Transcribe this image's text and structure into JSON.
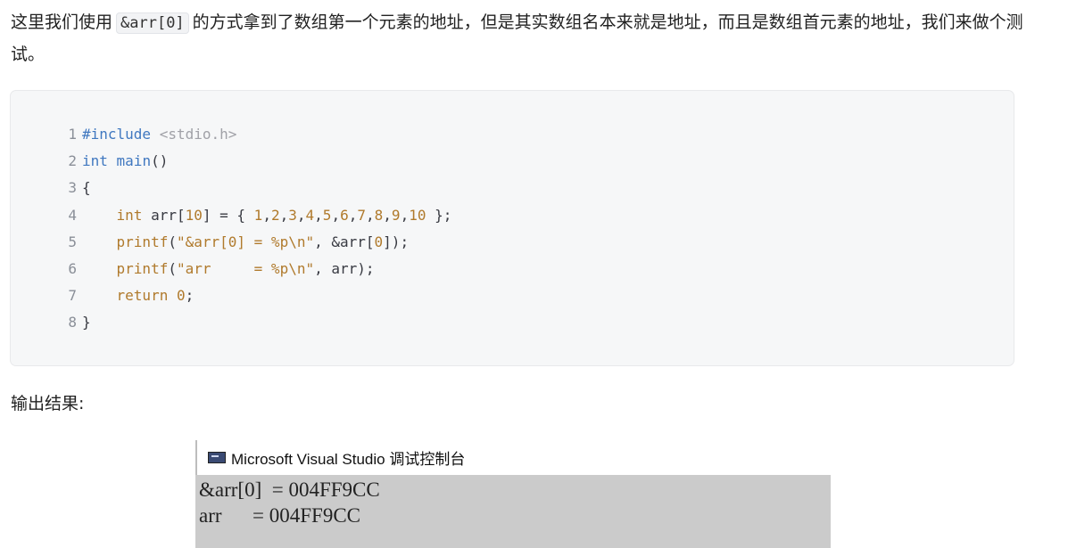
{
  "paragraph": {
    "before_code": "这里我们使用",
    "inline_code": "&arr[0]",
    "after_code": "的方式拿到了数组第一个元素的地址，但是其实数组名本来就是地址，而且是数组首元素的地址，我们来做个测试。"
  },
  "code_block": {
    "lines": [
      {
        "num": "1"
      },
      {
        "num": "2"
      },
      {
        "num": "3"
      },
      {
        "num": "4"
      },
      {
        "num": "5"
      },
      {
        "num": "6"
      },
      {
        "num": "7"
      },
      {
        "num": "8"
      }
    ],
    "tokens": {
      "l1_directive": "#include",
      "l1_header": " <stdio.h>",
      "l2_type": "int",
      "l2_fn": " main",
      "l2_rest": "()",
      "l3": "{",
      "l4_indent": "    ",
      "l4_type": "int",
      "l4_a": " arr[",
      "l4_size": "10",
      "l4_b": "] = { ",
      "l4_n1": "1",
      "l4_n2": "2",
      "l4_n3": "3",
      "l4_n4": "4",
      "l4_n5": "5",
      "l4_n6": "6",
      "l4_n7": "7",
      "l4_n8": "8",
      "l4_n9": "9",
      "l4_n10": "10",
      "l4_comma": ",",
      "l4_end": " };",
      "l5_indent": "    ",
      "l5_fn": "printf",
      "l5_open": "(",
      "l5_str": "\"&arr[0] = %p\\n\"",
      "l5_a": ", &arr[",
      "l5_zero": "0",
      "l5_end": "]);",
      "l6_indent": "    ",
      "l6_fn": "printf",
      "l6_open": "(",
      "l6_str": "\"arr     = %p\\n\"",
      "l6_end": ", arr);",
      "l7_indent": "    ",
      "l7_kw": "return",
      "l7_sp": " ",
      "l7_zero": "0",
      "l7_end": ";",
      "l8": "}"
    }
  },
  "output_label": "输出结果:",
  "console": {
    "title": "Microsoft Visual Studio 调试控制台",
    "icon": "console-app-icon",
    "lines": [
      "&arr[0]  = 004FF9CC",
      "arr      = 004FF9CC"
    ]
  }
}
